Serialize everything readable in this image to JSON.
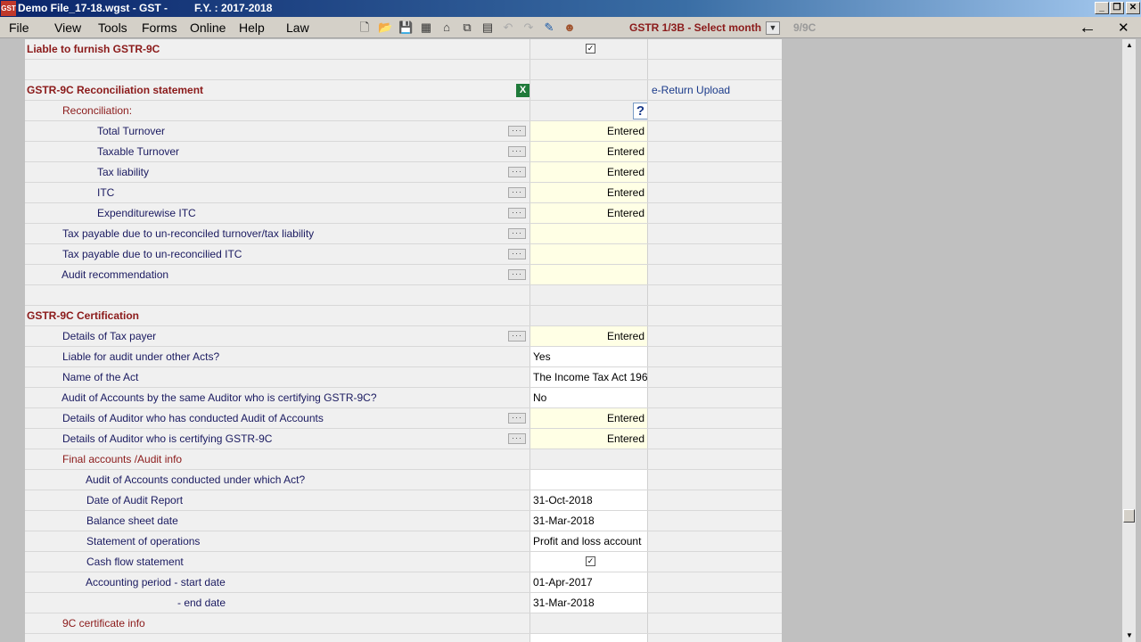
{
  "window": {
    "title": "Demo File_17-18.wgst - GST -",
    "fy": "F.Y. : 2017-2018",
    "app_icon": "GST"
  },
  "menubar": {
    "items": [
      "File",
      "View",
      "Tools",
      "Forms",
      "Online",
      "Help",
      "Law"
    ],
    "gstr_label": "GSTR 1/3B - Select month",
    "ninec_label": "9/9C"
  },
  "rows": [
    {
      "label": "Liable to furnish GSTR-9C",
      "style": "head",
      "value": "",
      "check": true
    },
    {
      "label": "",
      "value": ""
    },
    {
      "label": "GSTR-9C  Reconciliation statement",
      "style": "head",
      "value": "",
      "excel": true,
      "extra": "e-Return Upload"
    },
    {
      "label": "Reconciliation:",
      "style": "red",
      "value": "",
      "help": true
    },
    {
      "label": "Total Turnover",
      "value": "Entered",
      "dots": true
    },
    {
      "label": "Taxable Turnover",
      "value": "Entered",
      "dots": true
    },
    {
      "label": "Tax liability",
      "value": "Entered",
      "dots": true
    },
    {
      "label": "ITC",
      "value": "Entered",
      "dots": true
    },
    {
      "label": "Expenditurewise ITC",
      "value": "Entered",
      "dots": true
    },
    {
      "label": "Tax  payable due to un-reconciled turnover/tax liability",
      "value": "",
      "dots": true
    },
    {
      "label": "Tax payable due to un-reconcilied ITC",
      "value": "",
      "dots": true
    },
    {
      "label": "Audit recommendation",
      "value": "",
      "dots": true
    },
    {
      "label": "",
      "value": ""
    },
    {
      "label": "GSTR-9C Certification",
      "style": "head",
      "value": ""
    },
    {
      "label": "Details of Tax payer",
      "value": "Entered",
      "dots": true
    },
    {
      "label": "Liable for audit under other Acts?",
      "value": "Yes"
    },
    {
      "label": "Name of the Act",
      "value": "The Income Tax Act 196"
    },
    {
      "label": "Audit of Accounts by the same Auditor who is certifying GSTR-9C?",
      "value": "No"
    },
    {
      "label": "Details of Auditor who has conducted Audit of Accounts",
      "value": "Entered",
      "dots": true
    },
    {
      "label": "Details of Auditor who is certifying GSTR-9C",
      "value": "Entered",
      "dots": true
    },
    {
      "label": "Final accounts /Audit info",
      "style": "red",
      "value": ""
    },
    {
      "label": "Audit of Accounts conducted under which Act?",
      "value": ""
    },
    {
      "label": "Date of Audit Report",
      "value": "31-Oct-2018"
    },
    {
      "label": "Balance sheet date",
      "value": "31-Mar-2018"
    },
    {
      "label": "Statement of operations",
      "value": "Profit and loss account"
    },
    {
      "label": "Cash flow statement",
      "value": "",
      "check": true
    },
    {
      "label": "Accounting period - start date",
      "value": "01-Apr-2017"
    },
    {
      "label": "- end date",
      "value": "31-Mar-2018"
    },
    {
      "label": "9C certificate info",
      "style": "red",
      "value": ""
    },
    {
      "label": "",
      "value": ""
    }
  ]
}
